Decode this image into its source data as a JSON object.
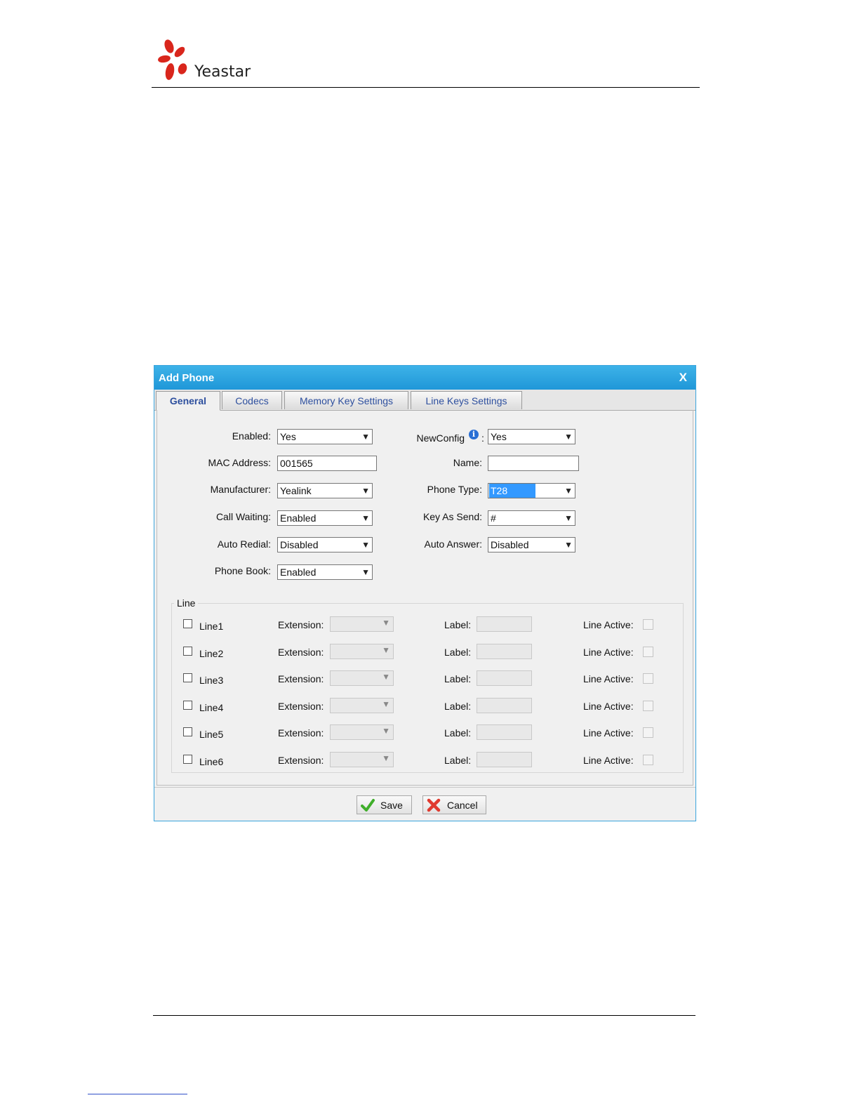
{
  "brand": {
    "name": "Yeastar"
  },
  "dialog": {
    "title": "Add Phone",
    "close_label": "X",
    "tabs": [
      {
        "label": "General",
        "active": true
      },
      {
        "label": "Codecs"
      },
      {
        "label": "Memory Key Settings"
      },
      {
        "label": "Line Keys Settings"
      }
    ],
    "fields": {
      "enabled": {
        "label": "Enabled:",
        "value": "Yes"
      },
      "mac": {
        "label": "MAC Address:",
        "value": "001565"
      },
      "manufacturer": {
        "label": "Manufacturer:",
        "value": "Yealink"
      },
      "call_waiting": {
        "label": "Call Waiting:",
        "value": "Enabled"
      },
      "auto_redial": {
        "label": "Auto Redial:",
        "value": "Disabled"
      },
      "phone_book": {
        "label": "Phone Book:",
        "value": "Enabled"
      },
      "newconfig": {
        "label": "NewConfig",
        "suffix": ":",
        "value": "Yes"
      },
      "name": {
        "label": "Name:",
        "value": ""
      },
      "phone_type": {
        "label": "Phone Type:",
        "value": "T28"
      },
      "key_as_send": {
        "label": "Key As Send:",
        "value": "#"
      },
      "auto_answer": {
        "label": "Auto Answer:",
        "value": "Disabled"
      }
    },
    "line_section": {
      "legend": "Line",
      "extension_label": "Extension:",
      "label_label": "Label:",
      "line_active_label": "Line Active:",
      "lines": [
        {
          "name": "Line1"
        },
        {
          "name": "Line2"
        },
        {
          "name": "Line3"
        },
        {
          "name": "Line4"
        },
        {
          "name": "Line5"
        },
        {
          "name": "Line6"
        }
      ]
    },
    "buttons": {
      "save": "Save",
      "cancel": "Cancel"
    }
  },
  "colors": {
    "titlebar": "#2aa6e2",
    "tab_text": "#2d4f9e",
    "selection": "#3399ff"
  },
  "icons": {
    "info": "info-icon",
    "save": "check-icon",
    "cancel": "x-icon"
  }
}
